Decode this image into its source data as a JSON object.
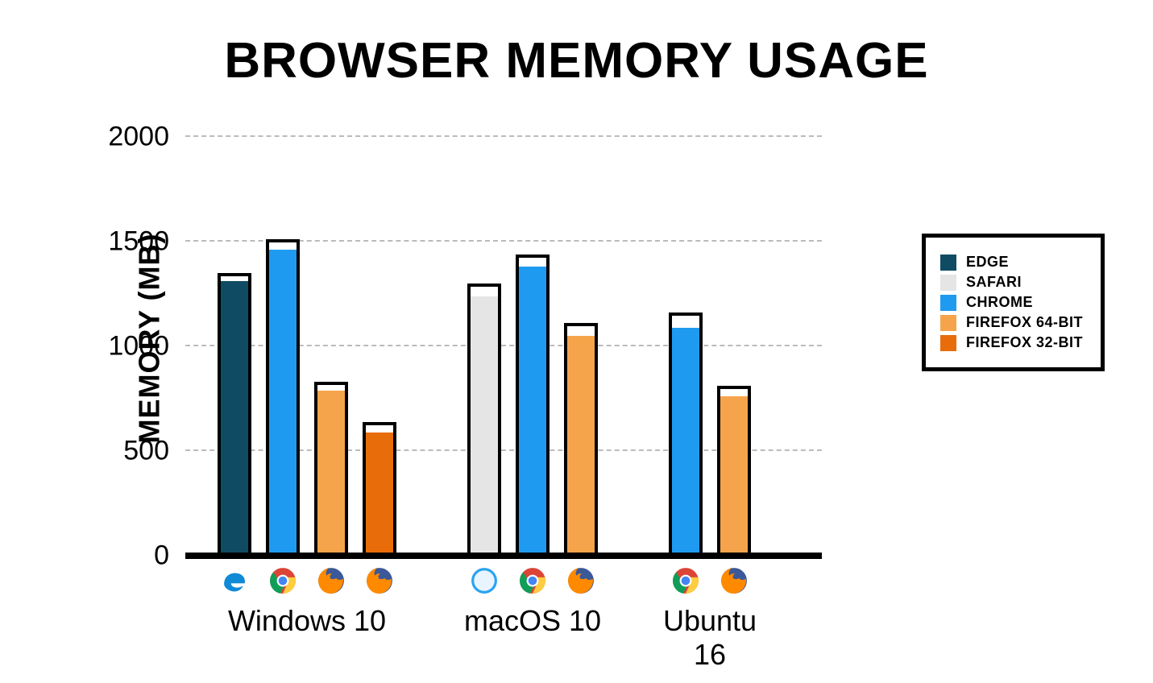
{
  "chart_data": {
    "type": "bar",
    "title": "BROWSER MEMORY USAGE",
    "ylabel": "MEMORY (MB)",
    "xlabel": "",
    "ylim": [
      0,
      2000
    ],
    "yticks": [
      0,
      500,
      1000,
      1500,
      2000
    ],
    "categories": [
      "Windows 10",
      "macOS 10",
      "Ubuntu 16"
    ],
    "series": [
      {
        "name": "EDGE",
        "color": "#0f4c64",
        "values": [
          {
            "fill": 1310,
            "outline": 1350
          },
          null,
          null
        ]
      },
      {
        "name": "SAFARI",
        "color": "#e5e5e5",
        "values": [
          null,
          {
            "fill": 1240,
            "outline": 1300
          },
          null
        ]
      },
      {
        "name": "CHROME",
        "color": "#1e9bf0",
        "values": [
          {
            "fill": 1460,
            "outline": 1510
          },
          {
            "fill": 1380,
            "outline": 1440
          },
          {
            "fill": 1090,
            "outline": 1160
          }
        ]
      },
      {
        "name": "FIREFOX 64-BIT",
        "color": "#f6a44b",
        "values": [
          {
            "fill": 790,
            "outline": 830
          },
          {
            "fill": 1050,
            "outline": 1110
          },
          {
            "fill": 760,
            "outline": 810
          }
        ]
      },
      {
        "name": "FIREFOX 32-BIT",
        "color": "#e86c0a",
        "values": [
          {
            "fill": 590,
            "outline": 640
          },
          null,
          null
        ]
      }
    ],
    "legend_position": "right",
    "grid": true,
    "icons": {
      "EDGE": "edge-icon",
      "SAFARI": "safari-icon",
      "CHROME": "chrome-icon",
      "FIREFOX 64-BIT": "firefox-icon",
      "FIREFOX 32-BIT": "firefox-icon"
    }
  },
  "title": "BROWSER MEMORY USAGE",
  "ylabel": "MEMORY (MB)",
  "yticks": {
    "0": "0",
    "1": "500",
    "2": "1000",
    "3": "1500",
    "4": "2000"
  },
  "xlabels": {
    "0": "Windows 10",
    "1": "macOS 10",
    "2": "Ubuntu 16"
  },
  "legend": {
    "0": "EDGE",
    "1": "SAFARI",
    "2": "CHROME",
    "3": "FIREFOX 64-BIT",
    "4": "FIREFOX 32-BIT"
  }
}
